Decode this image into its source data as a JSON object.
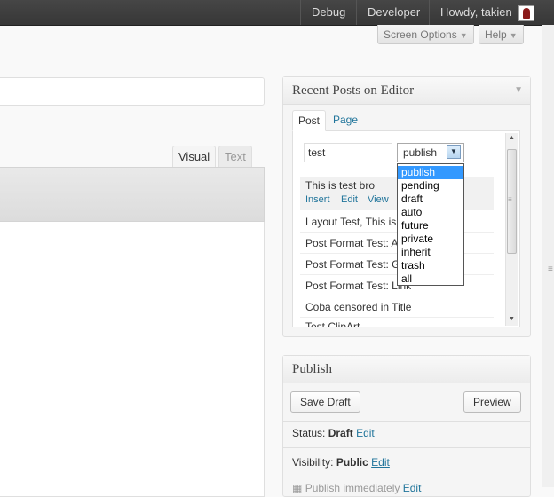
{
  "adminbar": {
    "debug_label": "Debug",
    "developer_label": "Developer",
    "howdy_label": "Howdy, takien"
  },
  "screen_meta": {
    "screen_options_label": "Screen Options",
    "help_label": "Help"
  },
  "editor": {
    "tab_visual": "Visual",
    "tab_text": "Text"
  },
  "recent_posts": {
    "title": "Recent Posts on Editor",
    "tab_post": "Post",
    "tab_page": "Page",
    "search_value": "test",
    "status_selected": "publish",
    "status_options": [
      "publish",
      "pending",
      "draft",
      "auto",
      "future",
      "private",
      "inherit",
      "trash",
      "all"
    ],
    "first_post": {
      "title": "This is test bro",
      "actions": [
        "Insert",
        "Edit",
        "View"
      ]
    },
    "posts": [
      "Layout Test, This is",
      "Post Format Test: A",
      "Post Format Test: G",
      "Post Format Test: Link",
      "Coba censored in Title",
      "Test ClipArt"
    ]
  },
  "publish": {
    "title": "Publish",
    "save_draft_label": "Save Draft",
    "preview_label": "Preview",
    "status_label": "Status:",
    "status_value": "Draft",
    "status_edit": "Edit",
    "visibility_label": "Visibility:",
    "visibility_value": "Public",
    "visibility_edit": "Edit",
    "publish_row": "Publish immediately",
    "publish_edit": "Edit"
  }
}
